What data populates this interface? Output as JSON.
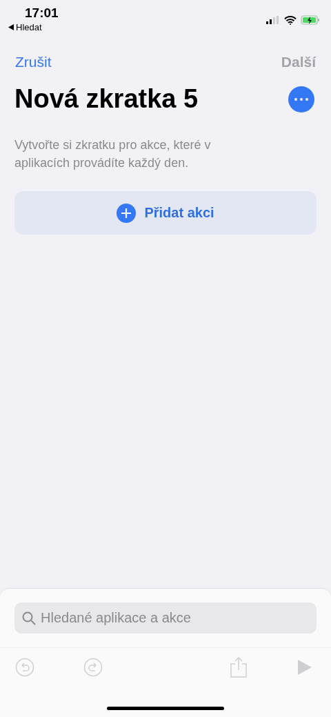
{
  "status_bar": {
    "time": "17:01",
    "back_label": "Hledat"
  },
  "nav": {
    "cancel": "Zrušit",
    "next": {
      "label": "Další",
      "disabled": true
    }
  },
  "title": "Nová zkratka 5",
  "description": "Vytvořte si zkratku pro akce, které v aplikacích provádíte každý den.",
  "add_action": "Přidat akci",
  "search": {
    "placeholder": "Hledané aplikace a akce"
  },
  "toolbar": [
    {
      "kind": "undo",
      "disabled": true
    },
    {
      "kind": "redo",
      "disabled": true
    },
    {
      "kind": "share",
      "disabled": true
    },
    {
      "kind": "play",
      "disabled": true
    }
  ]
}
